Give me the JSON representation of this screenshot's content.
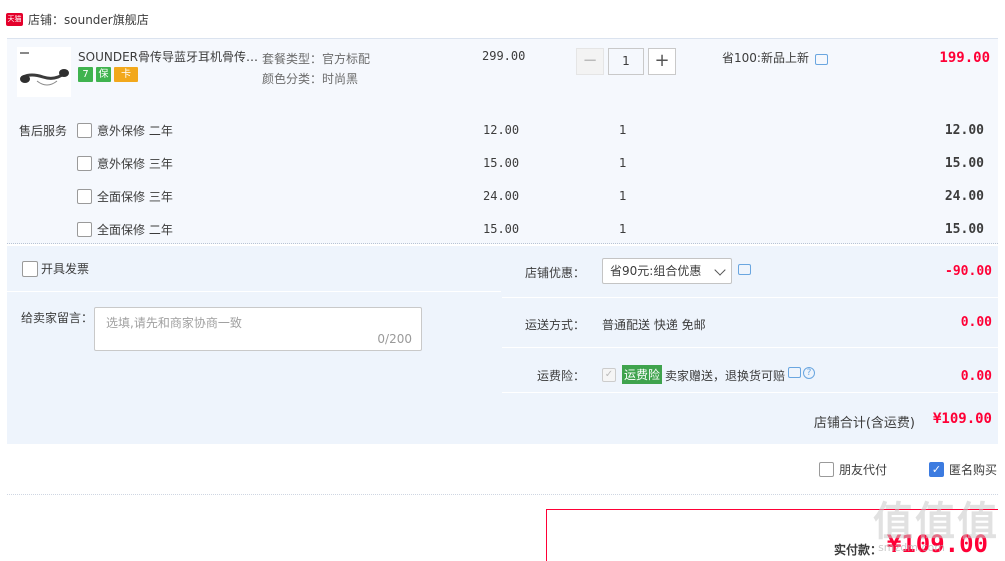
{
  "shop": {
    "badge": "天猫",
    "name": "店铺：sounder旗舰店"
  },
  "item": {
    "title": "SOUNDER骨传导蓝牙耳机骨传导运动耳机",
    "icons": [
      "7",
      "保",
      "卡"
    ],
    "sku": {
      "package": "套餐类型：官方标配",
      "color": "颜色分类：时尚黑"
    },
    "unit_price": "299.00",
    "qty": {
      "minus": "−",
      "value": "1",
      "plus": "+"
    },
    "discount": "省100:新品上新",
    "total": "199.00"
  },
  "after_sales": {
    "label": "售后服务",
    "services": [
      {
        "name": "意外保修 二年",
        "price": "12.00",
        "qty": "1",
        "total": "12.00"
      },
      {
        "name": "意外保修 三年",
        "price": "15.00",
        "qty": "1",
        "total": "15.00"
      },
      {
        "name": "全面保修 三年",
        "price": "24.00",
        "qty": "1",
        "total": "24.00"
      },
      {
        "name": "全面保修 二年",
        "price": "15.00",
        "qty": "1",
        "total": "15.00"
      }
    ]
  },
  "options": {
    "invoice": "开具发票",
    "message_label": "给卖家留言：",
    "message_placeholder": "选填,请先和商家协商一致",
    "message_count": "0/200",
    "shop_discount_label": "店铺优惠：",
    "shop_discount_value": "省90元:组合优惠",
    "shop_discount_amount": "-90.00",
    "shipping_label": "运送方式：",
    "shipping_value": "普通配送 快递 免邮",
    "shipping_amount": "0.00",
    "insurance_label": "运费险：",
    "insurance_tag": "运费险",
    "insurance_desc": "卖家赠送，退换货可赔",
    "insurance_help": "?",
    "insurance_amount": "0.00",
    "subtotal_label": "店铺合计(含运费)",
    "subtotal_amount": "¥109.00"
  },
  "payment": {
    "friend_pay": "朋友代付",
    "anonymous": "匿名购买",
    "actual_label": "实付款：",
    "actual_amount": "¥109.00"
  },
  "watermark": {
    "main": "值值值",
    "sub": "smzdm.com"
  },
  "colors": {
    "accent_red": "#ff0036",
    "panel_blue": "#eef4fc",
    "check_blue": "#3c7be0",
    "insurance_green": "#3fa34d"
  }
}
